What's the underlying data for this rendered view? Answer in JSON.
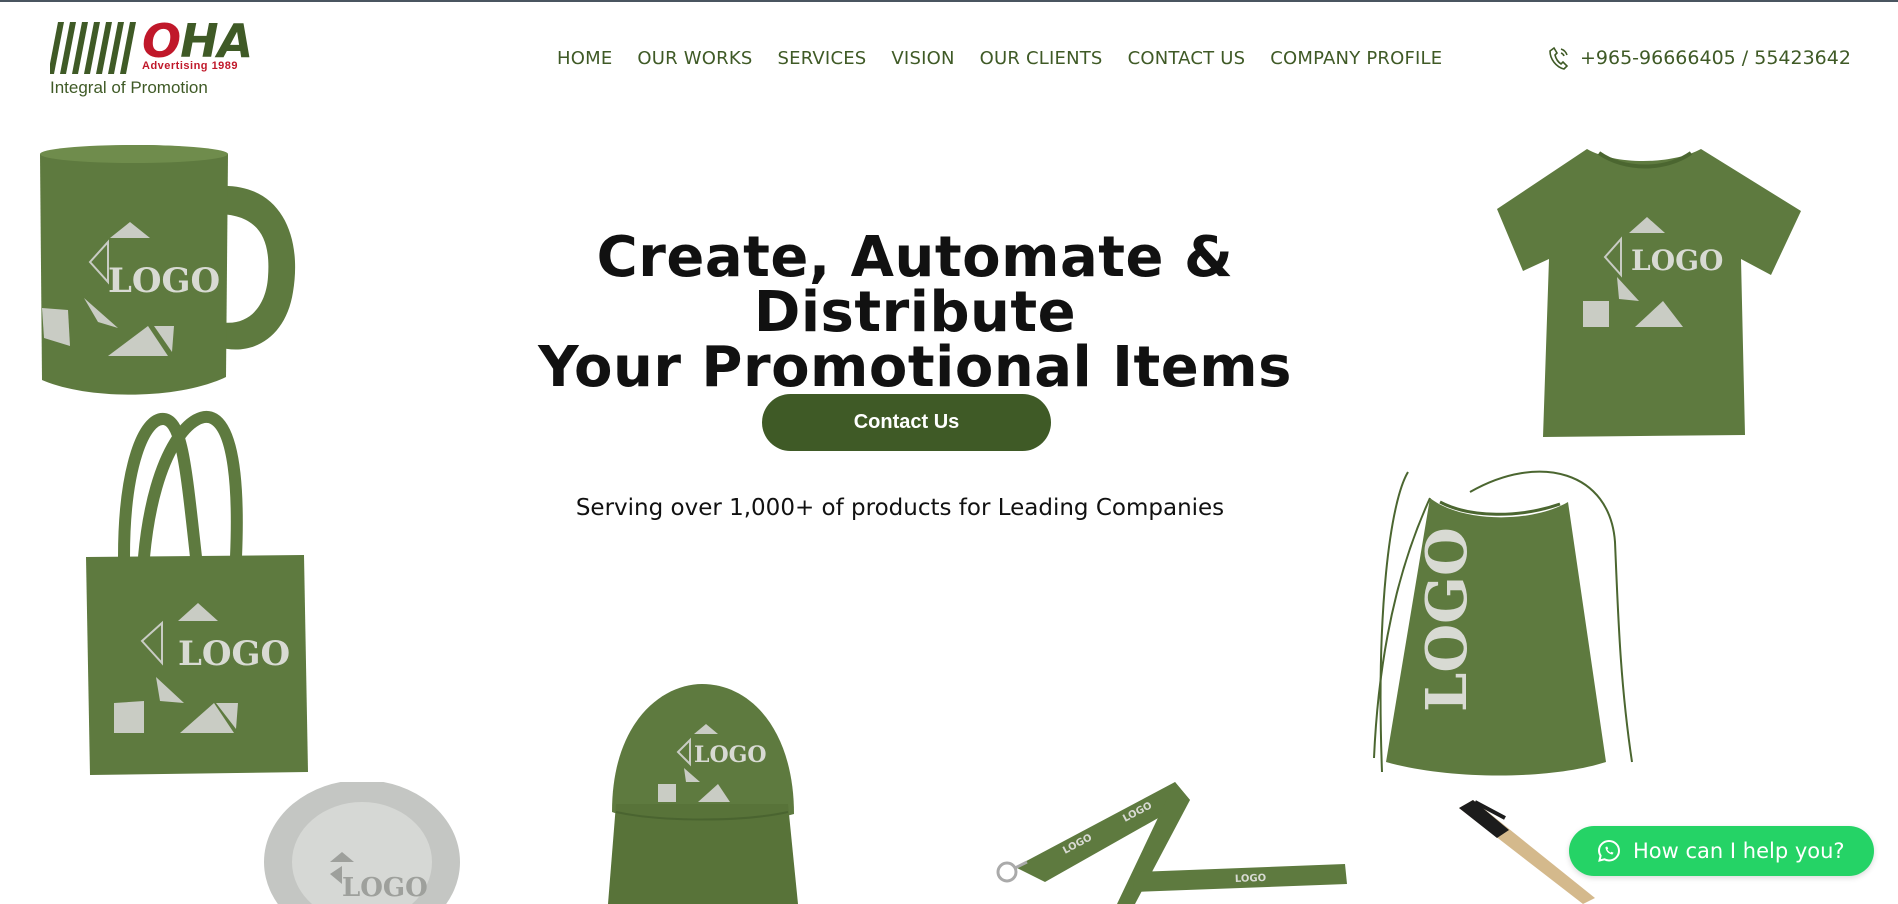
{
  "brand": {
    "name_part1": "O",
    "name_part2": "HA",
    "year_line": "Advertising 1989",
    "tagline": "Integral of Promotion"
  },
  "nav": {
    "items": [
      {
        "label": "HOME"
      },
      {
        "label": "OUR WORKS"
      },
      {
        "label": "SERVICES"
      },
      {
        "label": "VISION"
      },
      {
        "label": "OUR CLIENTS"
      },
      {
        "label": "CONTACT US"
      },
      {
        "label": "COMPANY PROFILE"
      }
    ]
  },
  "phone": {
    "icon": "phone-icon",
    "number": "+965-96666405 / 55423642"
  },
  "hero": {
    "title_line1": "Create, Automate & Distribute",
    "title_line2": "Your Promotional Items",
    "cta_label": "Contact Us",
    "subline": "Serving over 1,000+ of products for Leading Companies"
  },
  "products": {
    "logo_text": "LOGO",
    "items": [
      "mug",
      "tote-bag",
      "t-shirt",
      "drawstring-bag",
      "cap",
      "lanyard",
      "phone-grip",
      "pen"
    ]
  },
  "colors": {
    "brand_green": "#3f5a26",
    "product_green": "#5e7a3f",
    "accent_red": "#c0182a",
    "whatsapp_green": "#25d366"
  },
  "chat": {
    "icon": "whatsapp-icon",
    "label": "How can I help you?"
  }
}
